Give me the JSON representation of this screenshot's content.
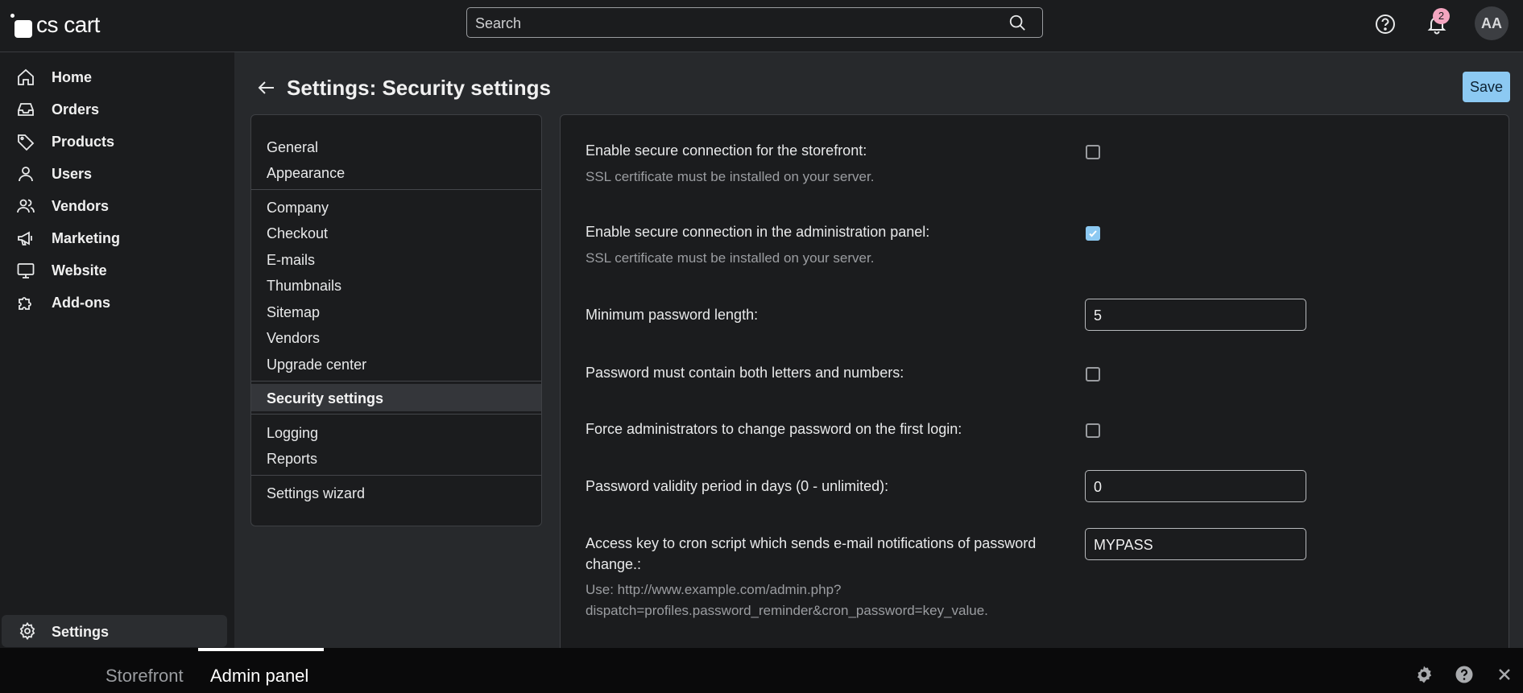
{
  "app": {
    "logo_text": "cs cart"
  },
  "search": {
    "placeholder": "Search"
  },
  "top_icons": {
    "help": "help-circle-icon",
    "notifications": "bell-icon",
    "notification_count": "2",
    "avatar_initials": "AA"
  },
  "sidebar": {
    "items": [
      {
        "label": "Home",
        "icon": "home-icon"
      },
      {
        "label": "Orders",
        "icon": "inbox-icon"
      },
      {
        "label": "Products",
        "icon": "tag-icon"
      },
      {
        "label": "Users",
        "icon": "user-icon"
      },
      {
        "label": "Vendors",
        "icon": "users-icon"
      },
      {
        "label": "Marketing",
        "icon": "megaphone-icon"
      },
      {
        "label": "Website",
        "icon": "monitor-icon"
      },
      {
        "label": "Add-ons",
        "icon": "puzzle-icon"
      }
    ],
    "settings_label": "Settings"
  },
  "header": {
    "title": "Settings: Security settings",
    "save_label": "Save"
  },
  "submenu": {
    "items": [
      "General",
      "Appearance",
      "Company",
      "Checkout",
      "E-mails",
      "Thumbnails",
      "Sitemap",
      "Vendors",
      "Upgrade center",
      "Security settings",
      "Logging",
      "Reports",
      "Settings wizard"
    ],
    "active": "Security settings"
  },
  "settings": {
    "secure_storefront": {
      "label": "Enable secure connection for the storefront:",
      "hint": "SSL certificate must be installed on your server.",
      "checked": false
    },
    "secure_admin": {
      "label": "Enable secure connection in the administration panel:",
      "hint": "SSL certificate must be installed on your server.",
      "checked": true
    },
    "min_password_length": {
      "label": "Minimum password length:",
      "value": "5"
    },
    "password_letters_numbers": {
      "label": "Password must contain both letters and numbers:",
      "checked": false
    },
    "force_change_first_login": {
      "label": "Force administrators to change password on the first login:",
      "checked": false
    },
    "password_validity": {
      "label": "Password validity period in days (0 - unlimited):",
      "value": "0"
    },
    "cron_access_key": {
      "label_line1": "Access key to cron script which sends e-mail notifications of password",
      "label_line2": "change.:",
      "hint_line1": "Use: http://www.example.com/admin.php?",
      "hint_line2": "dispatch=profiles.password_reminder&cron_password=key_value.",
      "value": "MYPASS"
    }
  },
  "bottom_bar": {
    "tabs": [
      "Storefront",
      "Admin panel"
    ],
    "active": "Admin panel",
    "icons": [
      "gear-icon",
      "help-icon",
      "close-icon"
    ]
  }
}
